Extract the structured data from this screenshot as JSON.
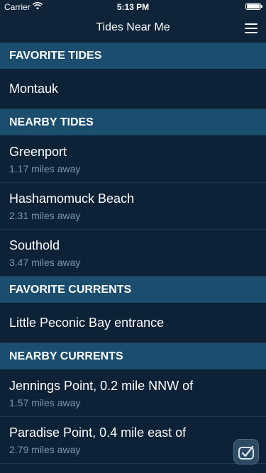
{
  "status_bar": {
    "carrier": "Carrier",
    "time": "5:13 PM",
    "wifi_icon": "wifi-icon",
    "battery_icon": "battery-icon"
  },
  "nav": {
    "title": "Tides Near Me",
    "menu_icon": "hamburger-menu-icon"
  },
  "sections": {
    "favorite_tides": {
      "header": "FAVORITE TIDES",
      "items": [
        {
          "name": "Montauk"
        }
      ]
    },
    "nearby_tides": {
      "header": "NEARBY TIDES",
      "items": [
        {
          "name": "Greenport",
          "distance": "1.17 miles away"
        },
        {
          "name": "Hashamomuck Beach",
          "distance": "2.31 miles away"
        },
        {
          "name": "Southold",
          "distance": "3.47 miles away"
        }
      ]
    },
    "favorite_currents": {
      "header": "FAVORITE CURRENTS",
      "items": [
        {
          "name": "Little Peconic Bay entrance"
        }
      ]
    },
    "nearby_currents": {
      "header": "NEARBY CURRENTS",
      "items": [
        {
          "name": "Jennings Point, 0.2 mile NNW of",
          "distance": "1.57 miles away"
        },
        {
          "name": "Paradise Point, 0.4 mile east of",
          "distance": "2.79 miles away"
        }
      ]
    }
  },
  "colors": {
    "background": "#0d2236",
    "section_header": "#1a4d6e",
    "secondary_text": "#7f97aa"
  }
}
